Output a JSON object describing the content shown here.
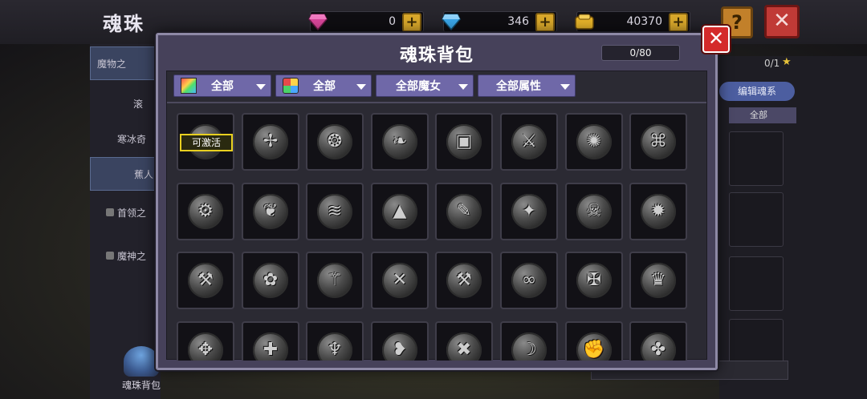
{
  "background": {
    "title": "魂珠",
    "currencies": [
      {
        "name": "pink-gem",
        "value": "0",
        "color": "#d9469a"
      },
      {
        "name": "blue-gem",
        "value": "346",
        "color": "#3aa6e8"
      },
      {
        "name": "gold-coin",
        "value": "40370",
        "color": "#e6b32a"
      }
    ],
    "help_label": "?",
    "close_label": "✕",
    "sidebar_items": [
      {
        "label": "魔物之",
        "selected": true
      },
      {
        "label": "滚",
        "selected": false
      },
      {
        "label": "寒冰奇",
        "selected": false
      },
      {
        "label": "蕉人",
        "selected": true
      },
      {
        "label": "首领之",
        "locked": true
      },
      {
        "label": "魔神之",
        "locked": true
      }
    ],
    "bag_label": "魂珠背包",
    "right_count": "0/1",
    "right_star": "★",
    "right_edit_label": "编辑魂系",
    "right_filter_label": "全部"
  },
  "modal": {
    "title": "魂珠背包",
    "capacity": "0/80",
    "close_label": "✕",
    "filters": [
      {
        "label": "全部",
        "icon": "rainbow-gradient-icon"
      },
      {
        "label": "全部",
        "icon": "four-color-icon"
      },
      {
        "label": "全部魔女",
        "icon": ""
      },
      {
        "label": "全部属性",
        "icon": ""
      }
    ],
    "activate_tag": "可激活",
    "slots": [
      {
        "icon": "bow-icon",
        "glyph": "➶"
      },
      {
        "icon": "axe-icon",
        "glyph": "✢"
      },
      {
        "icon": "swirl-icon",
        "glyph": "❂"
      },
      {
        "icon": "claw-icon",
        "glyph": "❧"
      },
      {
        "icon": "book-icon",
        "glyph": "▣"
      },
      {
        "icon": "sword-icon",
        "glyph": "⚔"
      },
      {
        "icon": "splash-icon",
        "glyph": "✺"
      },
      {
        "icon": "maze-icon",
        "glyph": "⌘"
      },
      {
        "icon": "gear-icon",
        "glyph": "⚙"
      },
      {
        "icon": "wing-icon",
        "glyph": "❦"
      },
      {
        "icon": "wave-icon",
        "glyph": "≋"
      },
      {
        "icon": "hat-icon",
        "glyph": "▲"
      },
      {
        "icon": "wrench-icon",
        "glyph": "✎"
      },
      {
        "icon": "spear-icon",
        "glyph": "✦"
      },
      {
        "icon": "skull-icon",
        "glyph": "☠"
      },
      {
        "icon": "dragon-icon",
        "glyph": "✹"
      },
      {
        "icon": "blade-icon",
        "glyph": "⚒"
      },
      {
        "icon": "flower-icon",
        "glyph": "✿"
      },
      {
        "icon": "staff-icon",
        "glyph": "⚚"
      },
      {
        "icon": "crossed-icon",
        "glyph": "✕"
      },
      {
        "icon": "hammer-icon",
        "glyph": "⚒"
      },
      {
        "icon": "chain-icon",
        "glyph": "∞"
      },
      {
        "icon": "rune-icon",
        "glyph": "✠"
      },
      {
        "icon": "mask-icon",
        "glyph": "♛"
      },
      {
        "icon": "lizard-icon",
        "glyph": "✥"
      },
      {
        "icon": "shield-icon",
        "glyph": "✚"
      },
      {
        "icon": "torch-icon",
        "glyph": "♆"
      },
      {
        "icon": "fish-icon",
        "glyph": "❥"
      },
      {
        "icon": "cross-icon",
        "glyph": "✖"
      },
      {
        "icon": "scythe-icon",
        "glyph": "☽"
      },
      {
        "icon": "fist-icon",
        "glyph": "✊"
      },
      {
        "icon": "beast-icon",
        "glyph": "✤"
      }
    ]
  }
}
